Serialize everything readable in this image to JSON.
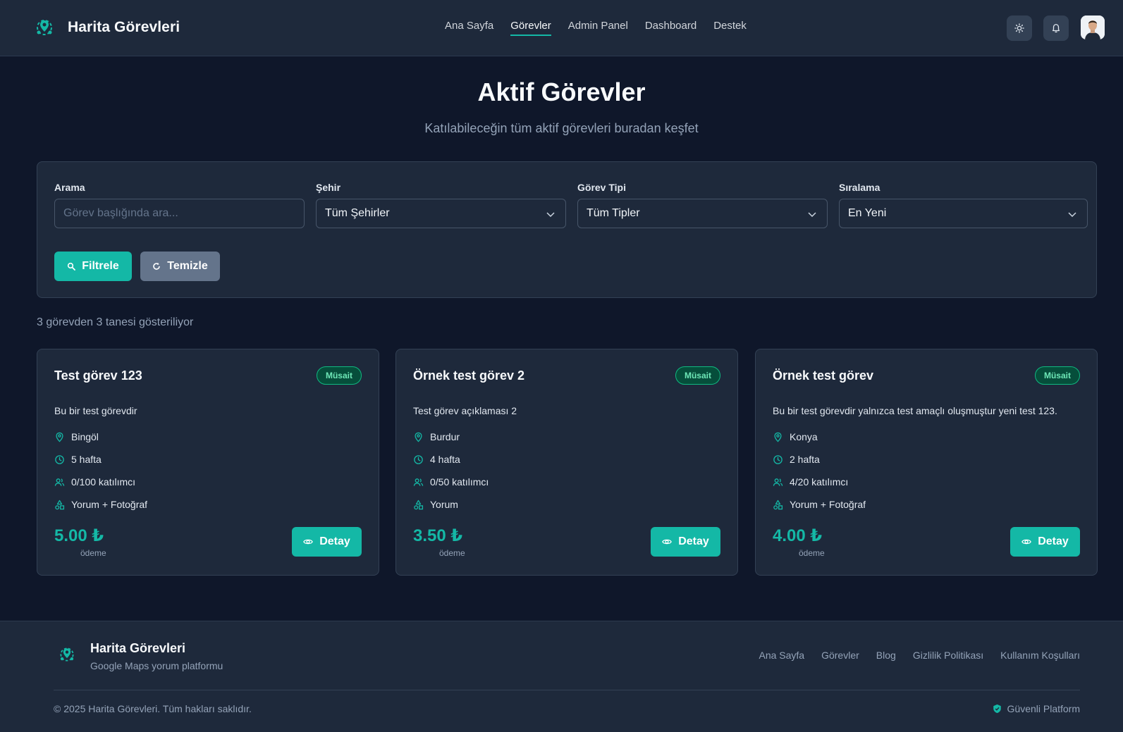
{
  "header": {
    "brand": "Harita Görevleri",
    "nav": [
      "Ana Sayfa",
      "Görevler",
      "Admin Panel",
      "Dashboard",
      "Destek"
    ],
    "active_nav": "Görevler",
    "icons": {
      "theme": "sun-icon",
      "notifications": "bell-icon",
      "avatar": "user-avatar"
    }
  },
  "hero": {
    "title": "Aktif Görevler",
    "subtitle": "Katılabileceğin tüm aktif görevleri buradan keşfet"
  },
  "filters": {
    "search_label": "Arama",
    "search_placeholder": "Görev başlığında ara...",
    "city_label": "Şehir",
    "city_value": "Tüm Şehirler",
    "type_label": "Görev Tipi",
    "type_value": "Tüm Tipler",
    "sort_label": "Sıralama",
    "sort_value": "En Yeni",
    "filter_button": "Filtrele",
    "clear_button": "Temizle"
  },
  "results_text": "3 görevden 3 tanesi gösteriliyor",
  "tasks": [
    {
      "title": "Test görev 123",
      "status": "Müsait",
      "description": "Bu bir test görevdir",
      "city": "Bingöl",
      "duration": "5 hafta",
      "participants": "0/100 katılımcı",
      "task_type": "Yorum + Fotoğraf",
      "price": "5.00 ₺",
      "price_label": "ödeme",
      "button": "Detay"
    },
    {
      "title": "Örnek test görev 2",
      "status": "Müsait",
      "description": "Test görev açıklaması 2",
      "city": "Burdur",
      "duration": "4 hafta",
      "participants": "0/50 katılımcı",
      "task_type": "Yorum",
      "price": "3.50 ₺",
      "price_label": "ödeme",
      "button": "Detay"
    },
    {
      "title": "Örnek test görev",
      "status": "Müsait",
      "description": "Bu bir test görevdir yalnızca test amaçlı oluşmuştur yeni test 123.",
      "city": "Konya",
      "duration": "2 hafta",
      "participants": "4/20 katılımcı",
      "task_type": "Yorum + Fotoğraf",
      "price": "4.00 ₺",
      "price_label": "ödeme",
      "button": "Detay"
    }
  ],
  "footer": {
    "brand": "Harita Görevleri",
    "tagline": "Google Maps yorum platformu",
    "links": [
      "Ana Sayfa",
      "Görevler",
      "Blog",
      "Gizlilik Politikası",
      "Kullanım Koşulları"
    ],
    "copyright": "© 2025 Harita Görevleri. Tüm hakları saklıdır.",
    "secure": "Güvenli Platform"
  },
  "colors": {
    "accent": "#14b8a6",
    "background": "#0f172a",
    "surface": "#1e293b",
    "badge": "#10b981"
  }
}
